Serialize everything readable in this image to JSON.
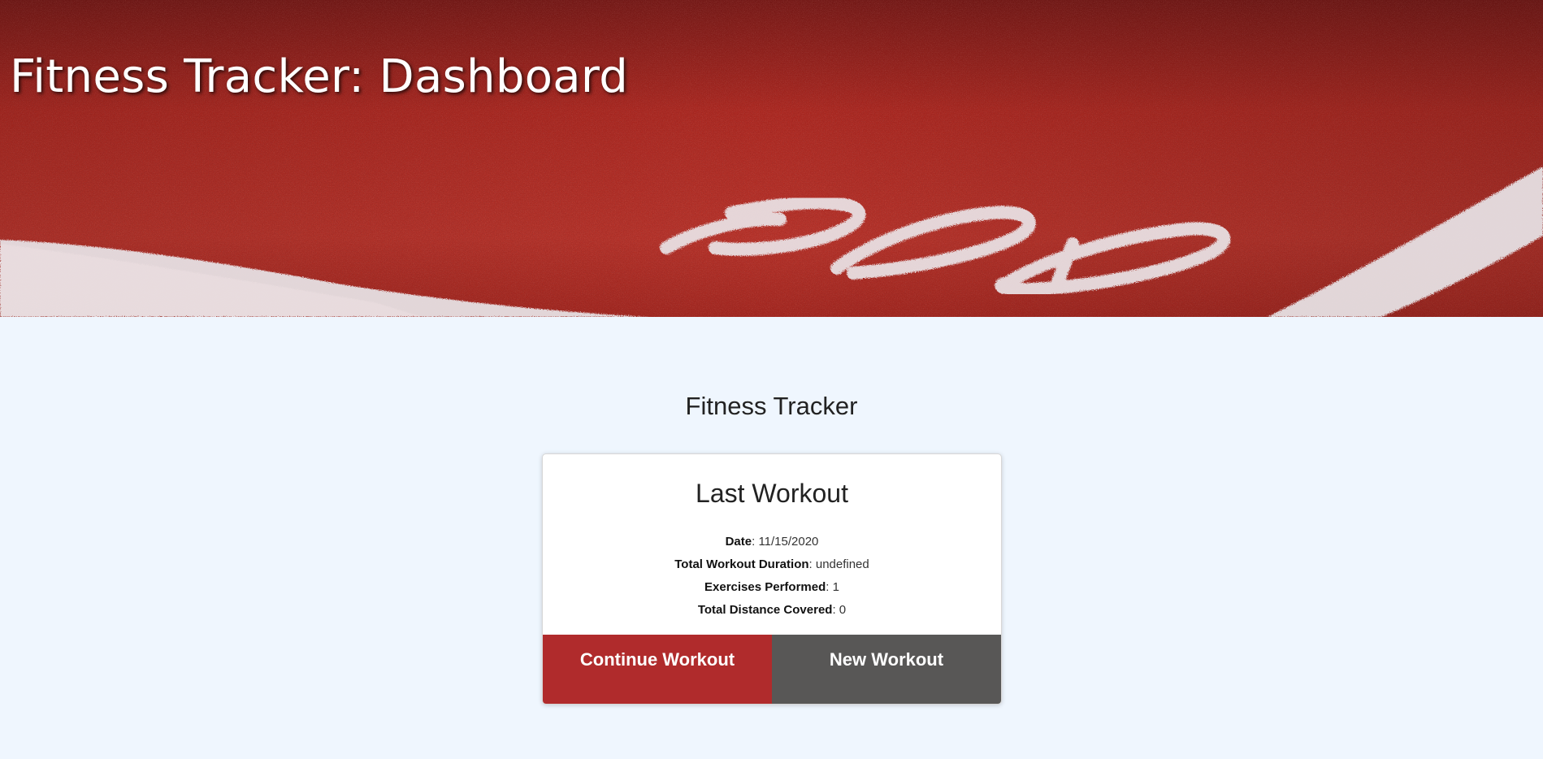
{
  "header": {
    "title": "Fitness Tracker: Dashboard"
  },
  "main": {
    "heading": "Fitness Tracker"
  },
  "last_workout": {
    "title": "Last Workout",
    "stats": [
      {
        "label": "Date",
        "value": ": 11/15/2020"
      },
      {
        "label": "Total Workout Duration",
        "value": ": undefined"
      },
      {
        "label": "Exercises Performed",
        "value": ": 1"
      },
      {
        "label": "Total Distance Covered",
        "value": ": 0"
      }
    ]
  },
  "buttons": {
    "continue_label": "Continue Workout",
    "new_label": "New Workout"
  },
  "colors": {
    "page_background": "#eff6fe",
    "track_red": "#a8231b",
    "continue_button": "#b02b2c",
    "new_button": "#585756"
  },
  "icons": {
    "hero_image": "running-track-image"
  }
}
